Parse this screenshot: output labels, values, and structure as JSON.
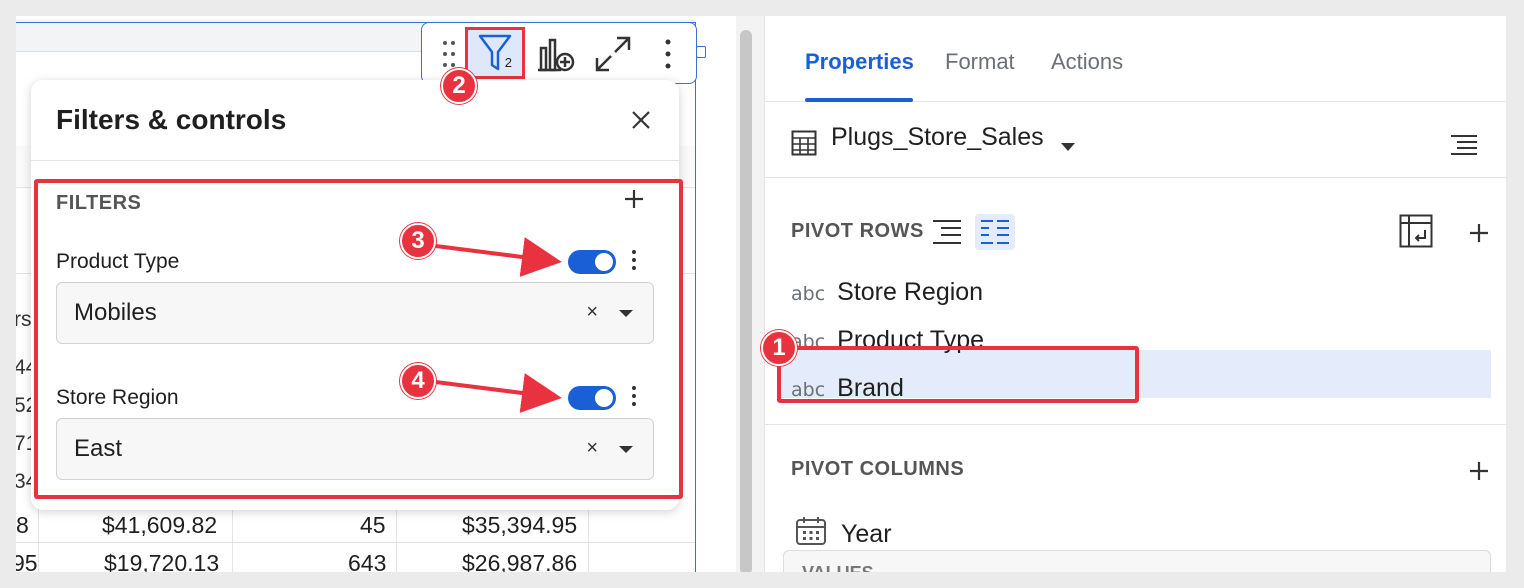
{
  "table": {
    "left_fragments": [
      "rs",
      "44",
      "52",
      "71",
      "34"
    ],
    "rows": [
      {
        "lead": "8",
        "col1": "$41,609.82",
        "col2": "45",
        "col3": "$35,394.95"
      },
      {
        "lead": "95",
        "col1": "$19,720.13",
        "col2": "643",
        "col3": "$26,987.86"
      }
    ]
  },
  "toolbar": {
    "filter_count": "2"
  },
  "filters_panel": {
    "title": "Filters & controls",
    "section_label": "FILTERS",
    "filters": [
      {
        "label": "Product Type",
        "value": "Mobiles",
        "enabled": true
      },
      {
        "label": "Store Region",
        "value": "East",
        "enabled": true
      }
    ],
    "clear_glyph": "×"
  },
  "annotations": {
    "badges": [
      "1",
      "2",
      "3",
      "4"
    ],
    "color": "#e8323f"
  },
  "properties": {
    "tabs": [
      "Properties",
      "Format",
      "Actions"
    ],
    "active_tab": "Properties",
    "source": "Plugs_Store_Sales",
    "pivot_rows_label": "PIVOT ROWS",
    "pivot_rows": [
      {
        "type": "abc",
        "name": "Store Region"
      },
      {
        "type": "abc",
        "name": "Product Type"
      },
      {
        "type": "abc",
        "name": "Brand"
      }
    ],
    "pivot_columns_label": "PIVOT COLUMNS",
    "pivot_columns": [
      {
        "type": "calendar",
        "name": "Year"
      }
    ],
    "values_label": "VALUES"
  },
  "colors": {
    "accent": "#1a5fd6",
    "selection": "#e4ebfb"
  }
}
